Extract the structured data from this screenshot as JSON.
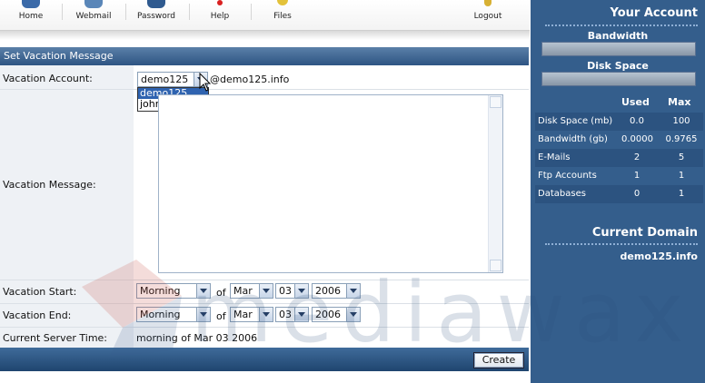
{
  "toolbar": {
    "items": [
      {
        "label": "Home",
        "icon": "home-icon",
        "color": "#3b6aa8"
      },
      {
        "label": "Webmail",
        "icon": "webmail-icon",
        "color": "#5a86b8"
      },
      {
        "label": "Password",
        "icon": "password-icon",
        "color": "#2f5a8f"
      },
      {
        "label": "Help",
        "icon": "help-icon",
        "color": "#d92020"
      },
      {
        "label": "Files",
        "icon": "files-icon",
        "color": "#e3c23a"
      },
      {
        "label": "Logout",
        "icon": "logout-icon",
        "color": "#d7b033"
      }
    ]
  },
  "form": {
    "header": "Set Vacation Message",
    "account_label": "Vacation Account:",
    "account_value": "demo125",
    "account_domain": "@demo125.info",
    "account_options": [
      "demo125",
      "john"
    ],
    "message_label": "Vacation Message:",
    "start_label": "Vacation Start:",
    "end_label": "Vacation End:",
    "time_label": "Current Server Time:",
    "time_value": "morning of Mar 03 2006",
    "of_text": "of",
    "start": {
      "period": "Morning",
      "month": "Mar",
      "day": "03",
      "year": "2006"
    },
    "end": {
      "period": "Morning",
      "month": "Mar",
      "day": "03",
      "year": "2006"
    },
    "create_label": "Create"
  },
  "sidebar": {
    "title": "Your Account",
    "bandwidth_label": "Bandwidth",
    "disk_label": "Disk Space",
    "col_used": "Used",
    "col_max": "Max",
    "rows": [
      {
        "name": "Disk Space (mb)",
        "used": "0.0",
        "max": "100"
      },
      {
        "name": "Bandwidth (gb)",
        "used": "0.0000",
        "max": "0.9765"
      },
      {
        "name": "E-Mails",
        "used": "2",
        "max": "5"
      },
      {
        "name": "Ftp Accounts",
        "used": "1",
        "max": "1"
      },
      {
        "name": "Databases",
        "used": "0",
        "max": "1"
      }
    ],
    "domain_title": "Current Domain",
    "domain_value": "demo125.info"
  },
  "watermark": {
    "text": "mediawax"
  },
  "colors": {
    "header": "#2e5583",
    "sidebar": "#345e8c",
    "selected_option": "#2f63b0"
  }
}
